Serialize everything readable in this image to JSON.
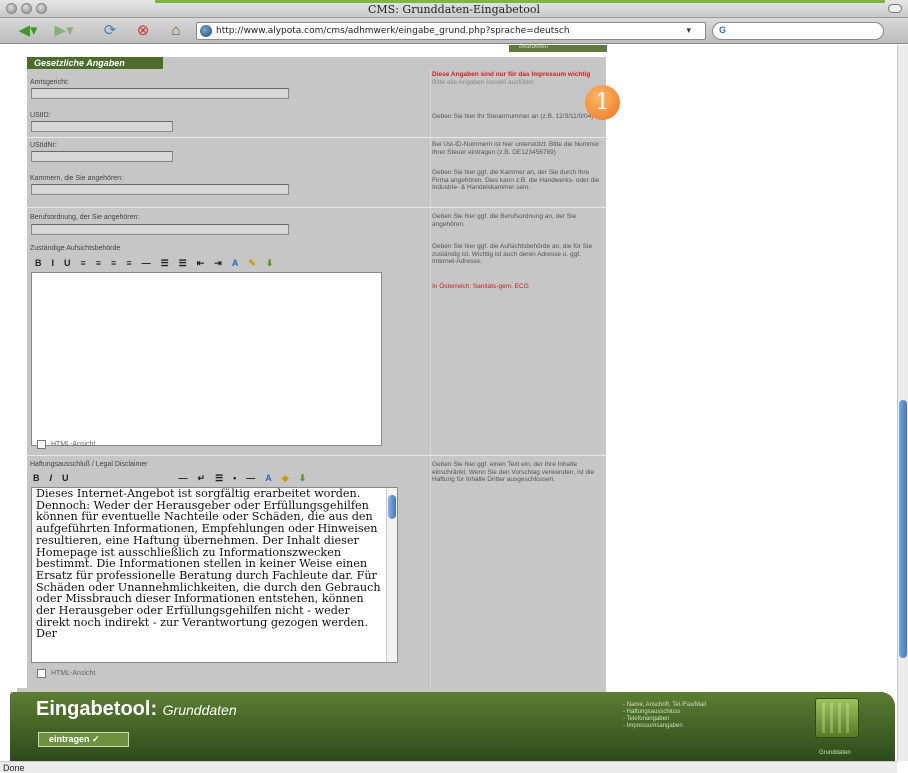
{
  "window": {
    "title": "CMS: Grunddaten-Eingabetool"
  },
  "browser": {
    "url": "http://www.alypota.com/cms/adhmwerk/eingabe_grund.php?sprache=deutsch",
    "search_engine_label": "G",
    "status": "Done"
  },
  "form": {
    "top_strip_label": "Bearbeiten",
    "section_tab": "Gesetzliche Angaben",
    "fields": {
      "amtsgericht": "Amtsgericht:",
      "ustid": "UStID:",
      "ustidnr": "UStIdNr:",
      "kammern": "Kammern, die Sie angehören:",
      "berufsordnung": "Berufsordnung, der Sie angehören:",
      "aufsichtsbehoerde": "Zuständige Aufsichtsbehörde",
      "haftungsausschluss": "Haftungsausschluß / Legal Disclaimer"
    },
    "hints": {
      "required": "Diese Angaben sind nur für das Impressum wichtig",
      "required_sub": "Bitte alle Angaben korrekt ausfüllen",
      "steuernummer": "Geben Sie hier Ihr Steuernummer an (z.B. 12/3/11/0/04)",
      "ustid": "Bei Ust-ID-Nummern ist hier unterstützt. Bitte die Nummer Ihrer Steuer eintragen (z.B. DE123456789)",
      "kammern": "Geben Sie hier ggf. die Kammer an, der Sie durch Ihre Firma angehören. Dies kann z.B. die Handwerks- oder die Industrie- & Handelskammer sein.",
      "berufsordnung": "Geben Sie hier ggf. die Berufsordnung an, der Sie angehören.",
      "aufsicht": "Geben Sie hier ggf. die Aufsichtsbehörde an, die für Sie zuständig ist. Wichtig ist auch deren Adresse u. ggf. Internet-Adresse.",
      "aufsicht_red": "In Österreich: Sanitäts-gem. ECG",
      "disclaimer": "Geben Sie hier ggf. einen Text ein, der Ihre Inhalte einschränkt. Wenn Sie den Vorschlag verwenden, ist die Haftung für Inhalte Dritter ausgeschlossen."
    },
    "editor1_toolbar": [
      "B",
      "I",
      "U",
      "≡",
      "≡",
      "≡",
      "≡",
      "—",
      "☰",
      "☰",
      "⇤",
      "⇥",
      "A",
      "✎",
      "⬇"
    ],
    "editor2_toolbar": [
      "B",
      "I",
      "U",
      "—",
      "↵",
      "☰",
      "•",
      "—",
      "A",
      "◆",
      "⬇"
    ],
    "html_view_label": "HTML-Ansicht",
    "disclaimer_text": "Dieses Internet-Angebot ist sorgfältig erarbeitet worden. Dennoch: Weder der Herausgeber oder Erfüllungsgehilfen können für eventuelle Nachteile oder Schäden, die aus den aufgeführten Informationen, Empfehlungen oder Hinweisen resultieren, eine Haftung übernehmen. Der Inhalt dieser Homepage ist ausschließlich zu Informationszwecken bestimmt. Die Informationen stellen in keiner Weise einen Ersatz für professionelle Beratung durch Fachleute dar. Für Schäden oder Unannehmlichkeiten, die durch den Gebrauch oder Missbrauch dieser Informationen entstehen, können der Herausgeber oder Erfüllungsgehilfen nicht - weder direkt noch indirekt - zur Verantwortung gezogen werden. Der"
  },
  "badge": {
    "number": "1"
  },
  "footer": {
    "title": "Eingabetool:",
    "subtitle": "Grunddaten",
    "button": "eintragen ✓",
    "links": [
      "- Name, Anschrift, Tel./Fax/Mail",
      "- Haftungsausschluss",
      "- Telefonangaben",
      "- Impressumsangaben"
    ],
    "box_caption": "Grunddaten"
  },
  "colors": {
    "panel": "#c6c6c6",
    "brand_green": "#4d6b2b",
    "badge": "#ec7420",
    "hint_red": "#d02020"
  }
}
